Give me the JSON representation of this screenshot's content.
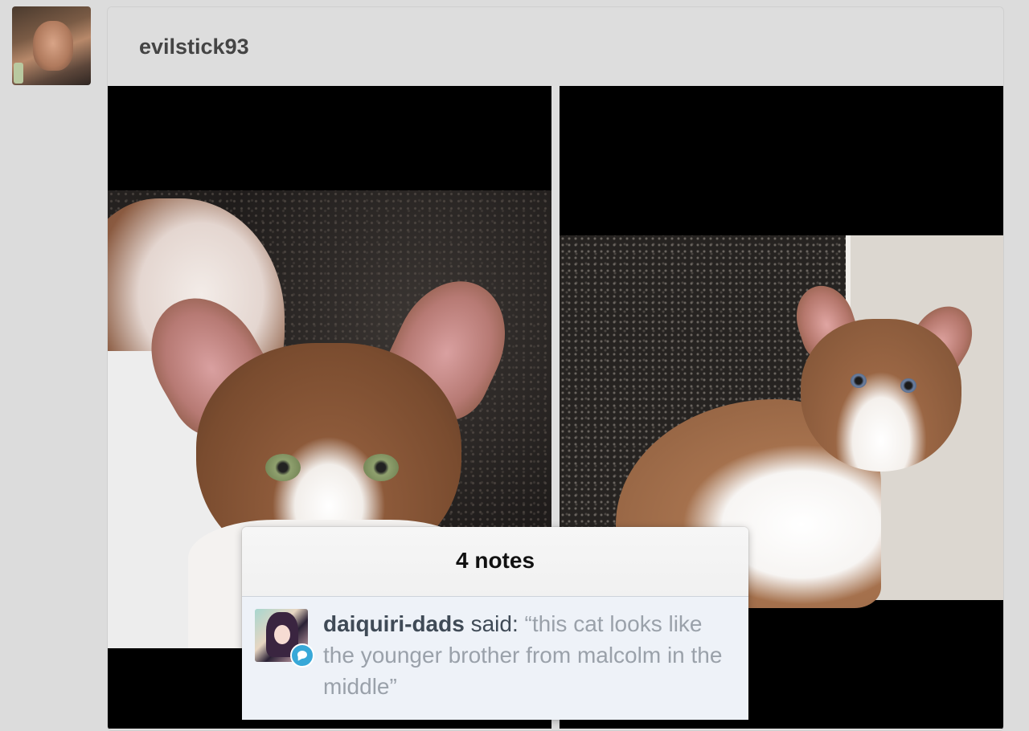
{
  "post": {
    "username": "evilstick93",
    "photo_count": 2
  },
  "notes": {
    "title": "4 notes",
    "items": [
      {
        "user": "daiquiri-dads",
        "action": "said:",
        "text": "“this cat looks like the younger brother from malcolm in the middle”",
        "badge_icon": "reply-bubble-icon"
      }
    ]
  },
  "colors": {
    "background": "#dcdcdc",
    "badge_blue": "#38a8d8",
    "username_text": "#444444",
    "note_text": "#9aa1aa"
  }
}
